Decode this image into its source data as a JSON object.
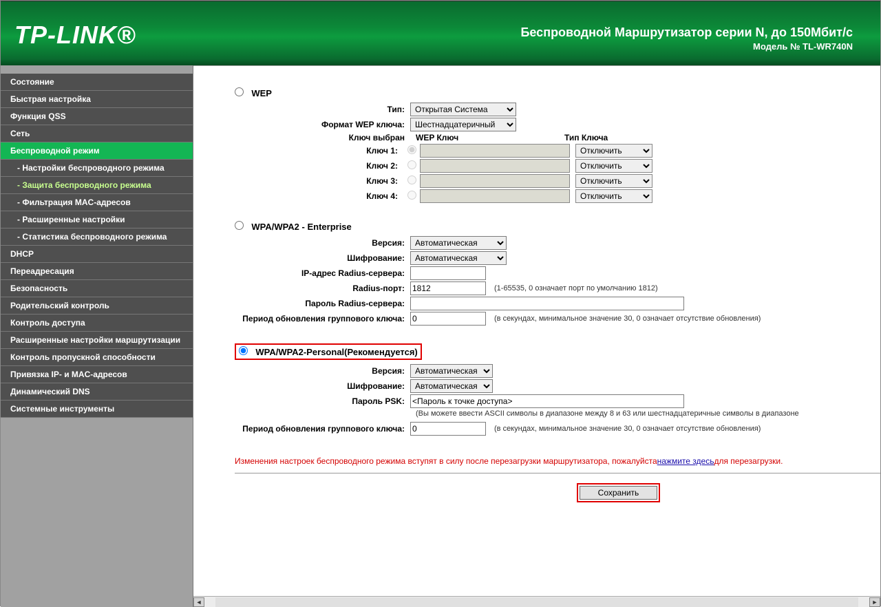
{
  "header": {
    "logo": "TP-LINK®",
    "headline": "Беспроводной Маршрутизатор серии N, до 150Мбит/с",
    "model": "Модель № TL-WR740N"
  },
  "sidebar": {
    "items": [
      {
        "label": "Состояние"
      },
      {
        "label": "Быстрая настройка"
      },
      {
        "label": "Функция QSS"
      },
      {
        "label": "Сеть"
      },
      {
        "label": "Беспроводной режим",
        "expanded": true,
        "sub": [
          {
            "label": "- Настройки беспроводного режима"
          },
          {
            "label": "- Защита беспроводного режима",
            "active": true
          },
          {
            "label": "- Фильтрация MAC-адресов"
          },
          {
            "label": "- Расширенные настройки"
          },
          {
            "label": "- Статистика беспроводного режима"
          }
        ]
      },
      {
        "label": "DHCP"
      },
      {
        "label": "Переадресация"
      },
      {
        "label": "Безопасность"
      },
      {
        "label": "Родительский контроль"
      },
      {
        "label": "Контроль доступа"
      },
      {
        "label": "Расширенные настройки маршрутизации"
      },
      {
        "label": "Контроль пропускной способности"
      },
      {
        "label": "Привязка IP- и MAC-адресов"
      },
      {
        "label": "Динамический DNS"
      },
      {
        "label": "Системные инструменты"
      }
    ]
  },
  "wep": {
    "title": "WEP",
    "type_label": "Тип:",
    "type_value": "Открытая Система",
    "format_label": "Формат WEP ключа:",
    "format_value": "Шестнадцатеричный",
    "selected_label": "Ключ выбран",
    "key_col": "WEP Ключ",
    "type_col": "Тип Ключа",
    "keys": [
      {
        "label": "Ключ 1:",
        "sel": "Отключить"
      },
      {
        "label": "Ключ 2:",
        "sel": "Отключить"
      },
      {
        "label": "Ключ 3:",
        "sel": "Отключить"
      },
      {
        "label": "Ключ 4:",
        "sel": "Отключить"
      }
    ]
  },
  "ent": {
    "title": "WPA/WPA2 - Enterprise",
    "version_label": "Версия:",
    "version_value": "Автоматическая",
    "enc_label": "Шифрование:",
    "enc_value": "Автоматическая",
    "radius_ip_label": "IP-адрес Radius-сервера:",
    "radius_ip_value": "",
    "radius_port_label": "Radius-порт:",
    "radius_port_value": "1812",
    "radius_port_hint": "(1-65535, 0 означает порт по умолчанию 1812)",
    "radius_pw_label": "Пароль Radius-сервера:",
    "radius_pw_value": "",
    "group_label": "Период обновления группового ключа:",
    "group_value": "0",
    "group_hint": "(в секундах, минимальное значение 30, 0 означает отсутствие обновления)"
  },
  "psk": {
    "title": "WPA/WPA2-Personal(Рекомендуется)",
    "version_label": "Версия:",
    "version_value": "Автоматическая",
    "enc_label": "Шифрование:",
    "enc_value": "Автоматическая",
    "pw_label": "Пароль PSK:",
    "pw_value": "<Пароль к точке доступа>",
    "pw_hint": "(Вы можете ввести ASCII символы в диапазоне между 8 и 63 или шестнадцатеричные символы в диапазоне",
    "group_label": "Период обновления группового ключа:",
    "group_value": "0",
    "group_hint": "(в секундах, минимальное значение 30, 0 означает отсутствие обновления)"
  },
  "notice": {
    "pre": "Изменения настроек беспроводного режима вступят в силу после перезагрузки маршрутизатора, пожалуйста",
    "link": "нажмите здесь",
    "post": "для перезагрузки."
  },
  "save": "Сохранить"
}
